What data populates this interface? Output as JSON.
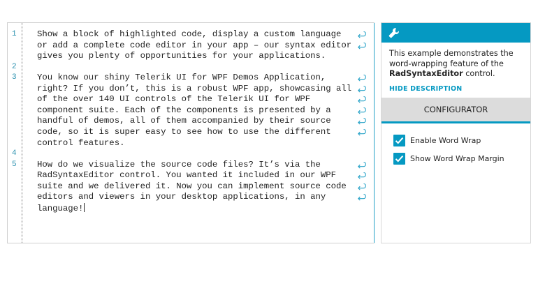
{
  "editor": {
    "lines": [
      {
        "num": "1",
        "text": "Show a block of highlighted code, display a custom language",
        "wrapped": true
      },
      {
        "num": "",
        "text": "or add a complete code editor in your app – our syntax editor",
        "wrapped": true
      },
      {
        "num": "",
        "text": "gives you plenty of opportunities for your applications.",
        "wrapped": false
      },
      {
        "num": "2",
        "text": "",
        "wrapped": false
      },
      {
        "num": "3",
        "text": "You know our shiny Telerik UI for WPF Demos Application,",
        "wrapped": true
      },
      {
        "num": "",
        "text": "right? If you don’t, this is a robust WPF app, showcasing all",
        "wrapped": true
      },
      {
        "num": "",
        "text": "of the over 140 UI controls of the Telerik UI for WPF",
        "wrapped": true
      },
      {
        "num": "",
        "text": "component suite. Each of the components is presented by a",
        "wrapped": true
      },
      {
        "num": "",
        "text": "handful of demos, all of them accompanied by their source",
        "wrapped": true
      },
      {
        "num": "",
        "text": "code, so it is super easy to see how to use the different",
        "wrapped": true
      },
      {
        "num": "",
        "text": "control features.",
        "wrapped": false
      },
      {
        "num": "4",
        "text": "",
        "wrapped": false
      },
      {
        "num": "5",
        "text": "How do we visualize the source code files? It’s via the",
        "wrapped": true
      },
      {
        "num": "",
        "text": "RadSyntaxEditor control. You wanted it included in our WPF",
        "wrapped": true
      },
      {
        "num": "",
        "text": "suite and we delivered it. Now you can implement source code",
        "wrapped": true
      },
      {
        "num": "",
        "text": "editors and viewers in your desktop applications, in any",
        "wrapped": true
      },
      {
        "num": "",
        "text": "language!",
        "wrapped": false
      }
    ]
  },
  "panel": {
    "icon": "wrench-icon",
    "description_prefix": "This example demonstrates the word-wrapping feature of the ",
    "description_bold": "RadSyntaxEditor",
    "description_suffix": " control.",
    "hide_description": "HIDE DESCRIPTION",
    "configurator_label": "CONFIGURATOR",
    "options": [
      {
        "label": "Enable Word Wrap",
        "checked": true
      },
      {
        "label": "Show Word Wrap Margin",
        "checked": true
      }
    ]
  },
  "colors": {
    "accent": "#0599c2",
    "line_numbers": "#2b91af",
    "wrap_margin": "#27a2c7"
  }
}
